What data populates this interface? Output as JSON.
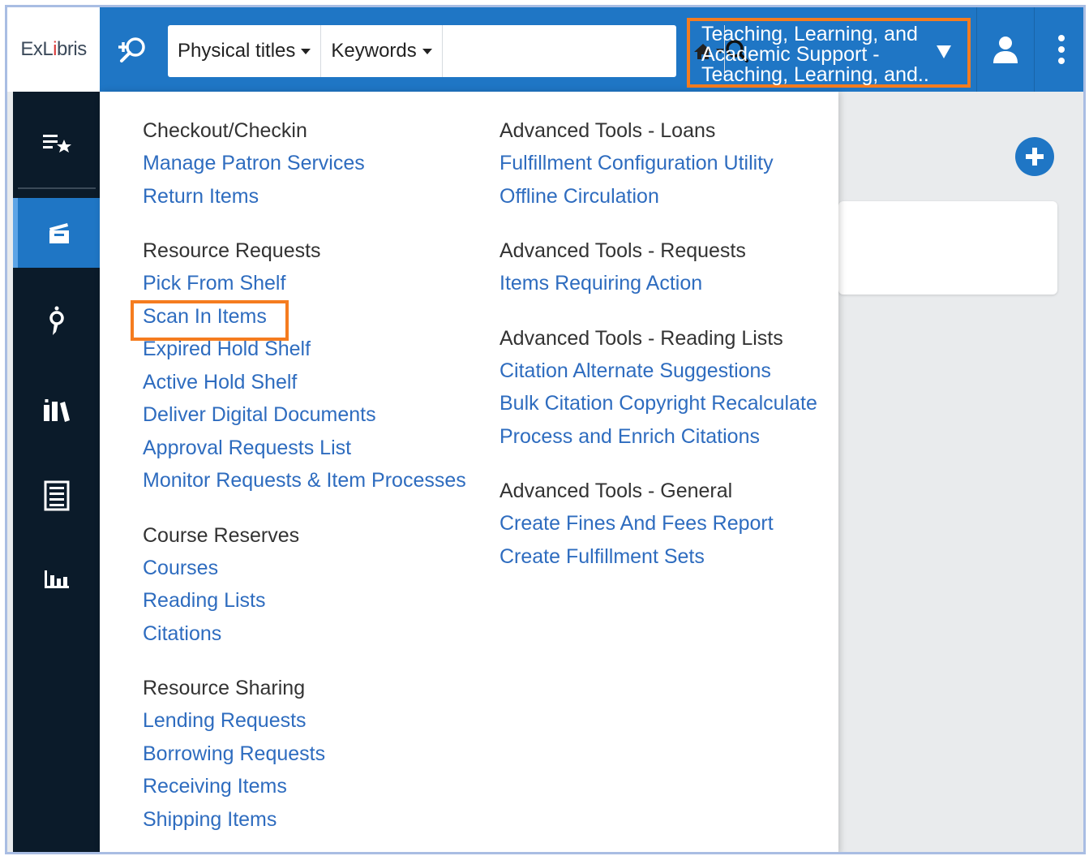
{
  "logo": {
    "part1": "ExL",
    "part2": "i",
    "part3": "bris"
  },
  "search": {
    "scope": "Physical titles",
    "field": "Keywords",
    "query": "",
    "placeholder": ""
  },
  "institution": {
    "line1": "Teaching, Learning, and",
    "line2": "Academic Support -",
    "line3": "Teaching, Learning, and..."
  },
  "menu": {
    "col1": [
      {
        "title": "Checkout/Checkin",
        "links": [
          "Manage Patron Services",
          "Return Items"
        ]
      },
      {
        "title": "Resource Requests",
        "links": [
          "Pick From Shelf",
          "Scan In Items",
          "Expired Hold Shelf",
          "Active Hold Shelf",
          "Deliver Digital Documents",
          "Approval Requests List",
          "Monitor Requests & Item Processes"
        ]
      },
      {
        "title": "Course Reserves",
        "links": [
          "Courses",
          "Reading Lists",
          "Citations"
        ]
      },
      {
        "title": "Resource Sharing",
        "links": [
          "Lending Requests",
          "Borrowing Requests",
          "Receiving Items",
          "Shipping Items"
        ]
      }
    ],
    "col2": [
      {
        "title": "Advanced Tools - Loans",
        "links": [
          "Fulfillment Configuration Utility",
          "Offline Circulation"
        ]
      },
      {
        "title": "Advanced Tools - Requests",
        "links": [
          "Items Requiring Action"
        ]
      },
      {
        "title": "Advanced Tools - Reading Lists",
        "links": [
          "Citation Alternate Suggestions",
          "Bulk Citation Copyright Recalculate",
          "Process and Enrich Citations"
        ]
      },
      {
        "title": "Advanced Tools - General",
        "links": [
          "Create Fines And Fees Report",
          "Create Fulfillment Sets"
        ]
      }
    ]
  },
  "colors": {
    "brand_blue": "#1f76c5",
    "nav_dark": "#0b1b2a",
    "link": "#2e6cbf",
    "highlight": "#f57c1f"
  },
  "icons": [
    "advanced-search-icon",
    "home-icon",
    "search-icon",
    "user-icon",
    "more-vertical-icon",
    "starred-list-icon",
    "fulfillment-icon",
    "acquisitions-icon",
    "resources-icon",
    "admin-icon",
    "analytics-icon",
    "add-icon"
  ]
}
